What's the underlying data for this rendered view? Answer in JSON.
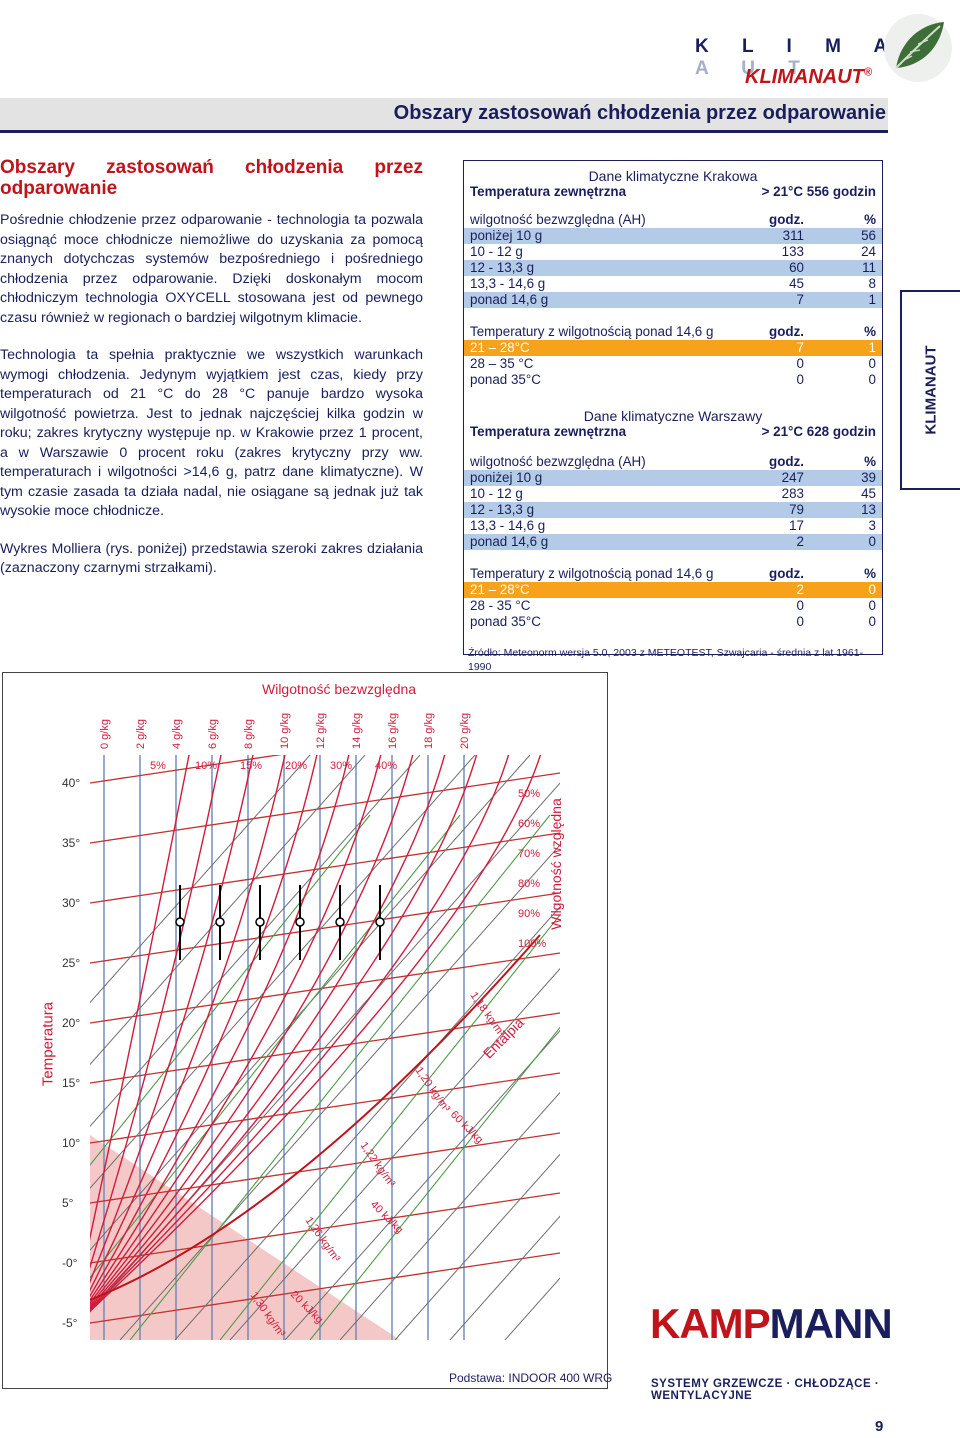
{
  "header": {
    "brand_spaced_dark": "K L I M A",
    "brand_spaced_light": "N A U T",
    "brand_name": "KLIMANAUT",
    "brand_reg": "®",
    "page_title": "Obszary zastosowań chłodzenia przez odparowanie"
  },
  "intro": {
    "heading": "Obszary zastosowań chłodzenia przez odparowanie",
    "paragraphs": [
      "Pośrednie chłodzenie przez odparowanie - technologia ta pozwala osiągnąć moce chłodnicze niemożliwe do uzyskania za pomocą znanych dotychczas systemów bezpośredniego i pośredniego chłodzenia przez odparowanie. Dzięki doskonałym mocom chłodniczym technologia OXYCELL stosowana jest od pewnego czasu również w regionach o bardziej wilgotnym klimacie.",
      "Technologia ta spełnia praktycznie we wszystkich warunkach wymogi chłodzenia. Jedynym wyjątkiem jest czas, kiedy przy temperaturach od 21 °C do 28 °C panuje bardzo wysoka wilgotność powietrza. Jest to jednak najczęściej kilka godzin w roku; zakres krytyczny występuje np. w Krakowie przez 1 procent, a w Warszawie 0 procent roku (zakres krytyczny przy ww. temperaturach i wilgotności >14,6 g, patrz dane klimatyczne). W tym czasie zasada ta działa nadal, nie osiągane są jednak już tak wysokie moce chłodnicze.",
      "Wykres Molliera (rys. poniżej) przedstawia szeroki zakres działania (zaznaczony czarnymi strzałkami)."
    ]
  },
  "climate": {
    "krakow": {
      "title": "Dane klimatyczne Krakowa",
      "temp_label": "Temperatura zewnętrzna",
      "temp_value": "> 21°C 556 godzin",
      "table1_header": [
        "wilgotność bezwzględna (AH)",
        "godz.",
        "%"
      ],
      "table1_rows": [
        [
          "poniżej 10 g",
          "311",
          "56"
        ],
        [
          "10 - 12 g",
          "133",
          "24"
        ],
        [
          "12 - 13,3 g",
          "60",
          "11"
        ],
        [
          "13,3 - 14,6 g",
          "45",
          "8"
        ],
        [
          "ponad 14,6 g",
          "7",
          "1"
        ]
      ],
      "table2_header": [
        "Temperatury z wilgotnością ponad 14,6 g",
        "godz.",
        "%"
      ],
      "table2_rows": [
        [
          "21 – 28°C",
          "7",
          "1"
        ],
        [
          "28 – 35 °C",
          "0",
          "0"
        ],
        [
          "ponad 35°C",
          "0",
          "0"
        ]
      ]
    },
    "warsaw": {
      "title": "Dane klimatyczne Warszawy",
      "temp_label": "Temperatura zewnętrzna",
      "temp_value": "> 21°C  628 godzin",
      "table1_header": [
        "wilgotność bezwzględna (AH)",
        "godz.",
        "%"
      ],
      "table1_rows": [
        [
          "poniżej 10 g",
          "247",
          "39"
        ],
        [
          "10 - 12 g",
          "283",
          "45"
        ],
        [
          "12 - 13,3 g",
          "79",
          "13"
        ],
        [
          "13,3 - 14,6 g",
          "17",
          "3"
        ],
        [
          "ponad 14,6 g",
          "2",
          "0"
        ]
      ],
      "table2_header": [
        "Temperatury z wilgotnością ponad 14,6 g",
        "godz.",
        "%"
      ],
      "table2_rows": [
        [
          "21 – 28°C",
          "2",
          "0"
        ],
        [
          "28 - 35 °C",
          "0",
          "0"
        ],
        [
          "ponad 35°C",
          "0",
          "0"
        ]
      ]
    },
    "source": "Źródło: Meteonorm wersja 5.0, 2003 z METEOTEST, Szwajcaria - średnia z lat 1961-1990"
  },
  "side_tab": "KLIMANAUT",
  "chart": {
    "top_label": "Wilgotność bezwzględna",
    "left_label": "Temperatura",
    "right_label": "Wilgotność względna",
    "entalpia_label": "Entalpia",
    "moisture_ticks": [
      "0 g/kg",
      "2 g/kg",
      "4 g/kg",
      "6 g/kg",
      "8 g/kg",
      "10 g/kg",
      "12 g/kg",
      "14 g/kg",
      "16 g/kg",
      "18 g/kg",
      "20 g/kg"
    ],
    "rh_ticks_top": [
      "5%",
      "10%",
      "15%",
      "20%",
      "30%",
      "40%"
    ],
    "rh_ticks_right": [
      "50%",
      "60%",
      "70%",
      "80%",
      "90%",
      "100%"
    ],
    "temp_ticks": [
      "40°",
      "35°",
      "30°",
      "25°",
      "20°",
      "15°",
      "10°",
      "5°",
      "-0°",
      "-5°"
    ],
    "density_labels": [
      "1,18 kg/m³",
      "1,20 kg/m³",
      "1,22 kg/m³",
      "1,26 kg/m³",
      "1,30 kg/m³"
    ],
    "enthalpy_labels": [
      "60 kJ/kg",
      "40 kJ/kg",
      "20 kJ/kg"
    ],
    "caption": "Podstawa: INDOOR 400 WRG"
  },
  "logo": {
    "part_red": "KAMP",
    "part_navy": "MANN",
    "tagline": "SYSTEMY GRZEWCZE · CHŁODZĄCE · WENTYLACYJNE"
  },
  "page_number": "9",
  "colors": {
    "navy": "#1a1f5c",
    "red": "#c0141b",
    "orange": "#f6a21a",
    "light_blue": "#b3cbe6"
  }
}
